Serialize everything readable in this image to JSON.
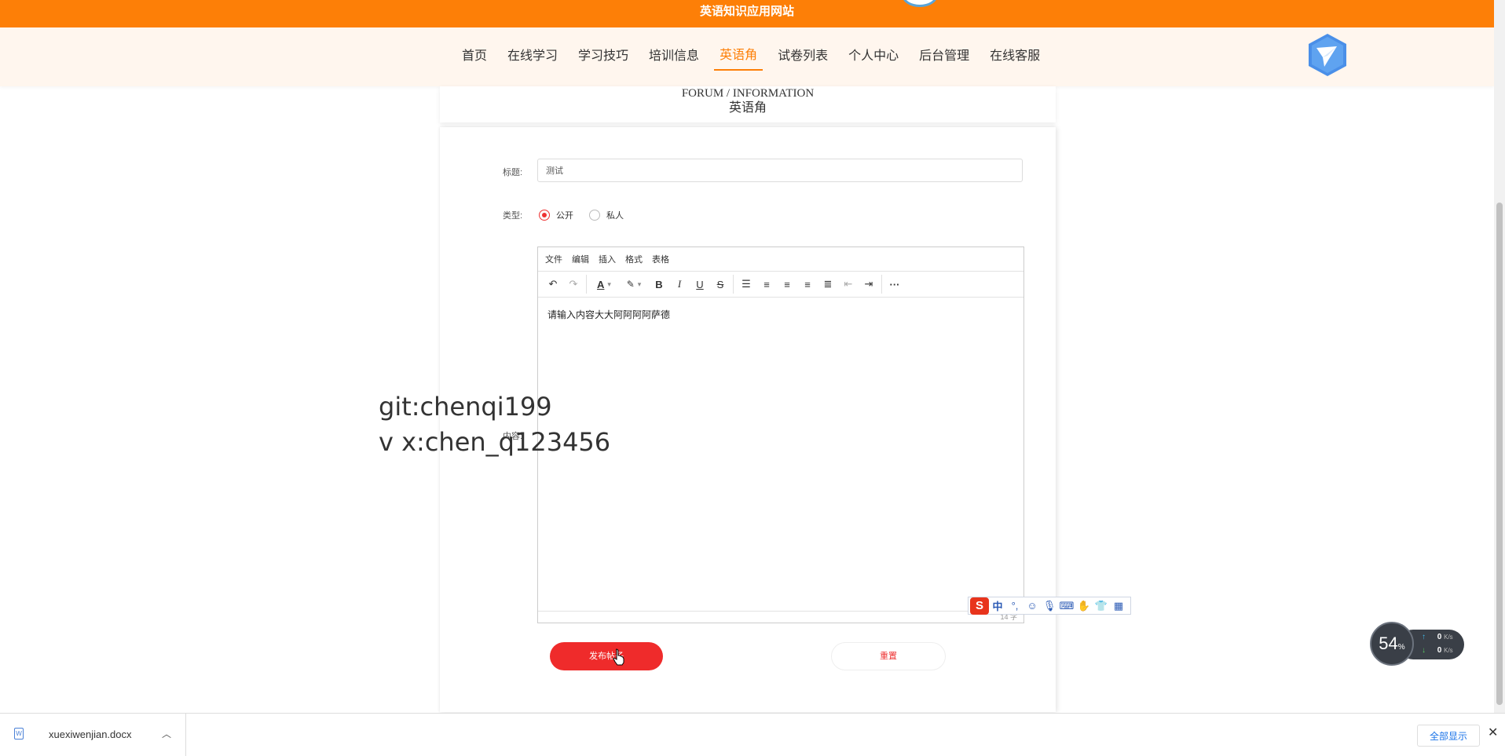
{
  "header": {
    "site_title": "英语知识应用网站"
  },
  "nav": {
    "items": [
      "首页",
      "在线学习",
      "学习技巧",
      "培训信息",
      "英语角",
      "试卷列表",
      "个人中心",
      "后台管理",
      "在线客服"
    ],
    "active_index": 4
  },
  "section": {
    "en_title": "FORUM / INFORMATION",
    "cn_title": "英语角"
  },
  "form": {
    "title_label": "标题:",
    "title_value": "测试",
    "type_label": "类型:",
    "type_options": [
      "公开",
      "私人"
    ],
    "type_selected": "公开",
    "content_label": "内容:",
    "editor": {
      "menus": [
        "文件",
        "编辑",
        "插入",
        "格式",
        "表格"
      ],
      "content": "请输入内容大大阿阿阿阿萨德",
      "word_count": "14 字"
    },
    "publish_label": "发布帖子",
    "reset_label": "重置"
  },
  "watermark": {
    "line1": "git:chenqi199",
    "line2": "v x:chen_q123456"
  },
  "ime": {
    "logo": "S",
    "mode": "中"
  },
  "speed_widget": {
    "percent": "54",
    "percent_unit": "%",
    "upload": "0",
    "download": "0",
    "unit": "K/s"
  },
  "download_bar": {
    "file_name": "xuexiwenjian.docx",
    "show_all": "全部显示"
  },
  "colors": {
    "brand": "#fd7f07",
    "danger": "#ef2b2b"
  }
}
